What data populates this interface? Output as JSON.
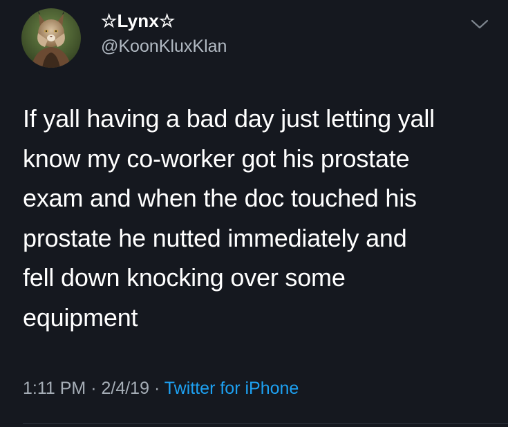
{
  "tweet": {
    "display_name": "☆Lynx☆",
    "handle": "@KoonKluxKlan",
    "text": "If yall having a bad day just letting yall\nknow my co-worker got his prostate\nexam and when the doc touched his\nprostate he nutted immediately and\nfell down knocking over some\nequipment",
    "time": "1:11 PM",
    "separator": "·",
    "date": "2/4/19",
    "source": "Twitter for iPhone"
  },
  "icons": {
    "menu": "chevron-down-icon",
    "avatar": "lynx-avatar"
  },
  "colors": {
    "background": "#15181f",
    "text": "#ffffff",
    "secondary_text": "#a6aeb7",
    "link": "#1da1f2"
  }
}
